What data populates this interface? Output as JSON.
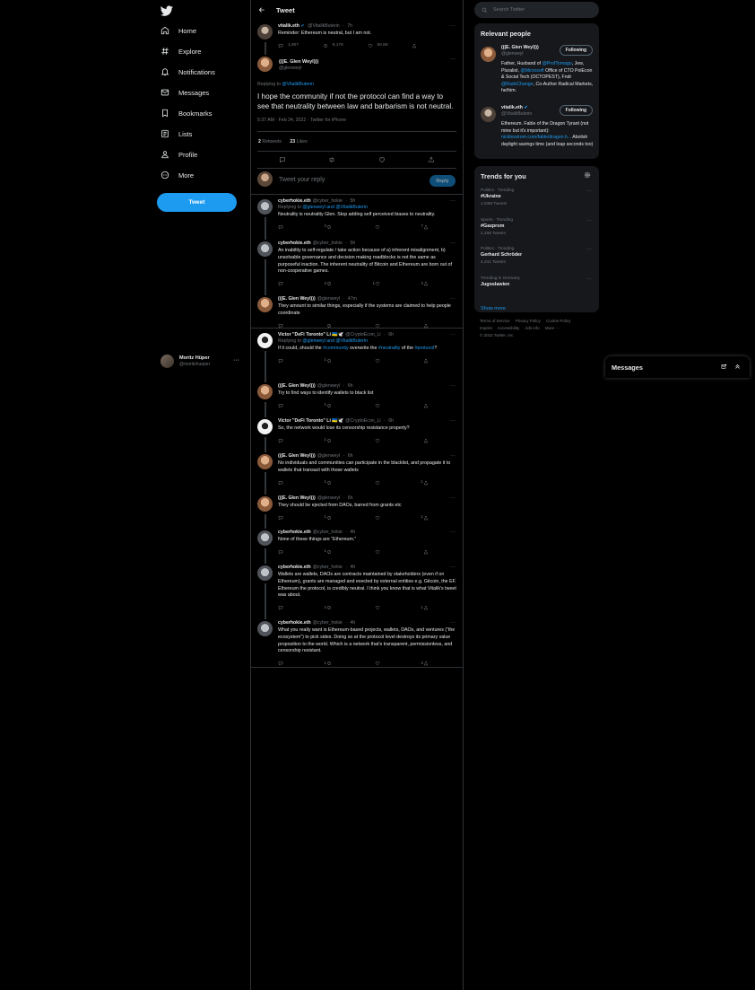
{
  "nav": {
    "items": [
      {
        "label": "Home",
        "icon": "home-icon"
      },
      {
        "label": "Explore",
        "icon": "explore-icon"
      },
      {
        "label": "Notifications",
        "icon": "notifications-icon"
      },
      {
        "label": "Messages",
        "icon": "messages-icon"
      },
      {
        "label": "Bookmarks",
        "icon": "bookmarks-icon"
      },
      {
        "label": "Lists",
        "icon": "lists-icon"
      },
      {
        "label": "Profile",
        "icon": "profile-icon"
      },
      {
        "label": "More",
        "icon": "more-icon"
      }
    ],
    "tweet_button": "Tweet",
    "account": {
      "name": "Moritz Hüper",
      "handle": "@moritzhueper"
    }
  },
  "header": {
    "title": "Tweet"
  },
  "quoted_parent": {
    "name": "vitalik.eth",
    "handle": "@VitalikButerin",
    "time": "7h",
    "text": "Reminder: Ethereum is neutral, but I am not.",
    "replies": "1,907",
    "retweets": "8,176",
    "likes": "50.8K"
  },
  "main_tweet": {
    "name": "(((E. Glen Weyl)))",
    "handle": "@glenweyl",
    "replying_prefix": "Replying to",
    "replying_to": "@VitalikButerin",
    "text": "I hope the community if not the protocol can find a way to see that neutrality between law and barbarism is not neutral.",
    "meta": "5:37 AM · Feb 24, 2022 · Twitter for iPhone",
    "retweets_count": "2",
    "retweets_label": "Retweets",
    "likes_count": "23",
    "likes_label": "Likes"
  },
  "composer": {
    "placeholder": "Tweet your reply",
    "button": "Reply"
  },
  "replies": [
    {
      "name": "cyberhokie.eth",
      "handle": "@cyber_hokie",
      "time": "5h",
      "av": "cyb",
      "replying": "Replying to ",
      "replying_to": "@glenweyl and @VitalikButerin",
      "text": "Neutrality is neutrality Glen. Stop adding self perceived biases to neutrality.",
      "r": "2",
      "rt": "",
      "l": "7",
      "thread": true
    },
    {
      "name": "cyberhokie.eth",
      "handle": "@cyber_hokie",
      "time": "5h",
      "av": "cyb",
      "text": "An inability to self-regulate / take action  because of a) inherent misalignment, b) unsolvable governance and decision making roadblocks is not the same as purposeful inaction. The inherent neutrality of Bitcoin and Ethereum are born out of non-cooperative games.",
      "r": "2",
      "rt": "1",
      "l": "3",
      "thread": true
    },
    {
      "name": "(((E. Glen Weyl)))",
      "handle": "@glenweyl",
      "time": "47m",
      "av": "glen",
      "text": "They amount to similar things, especially if the systems are claimed to help people coordinate",
      "r": "",
      "rt": "",
      "l": "",
      "sep": true
    },
    {
      "name": "Victor \"DeFi Toronto\" Li 🇺🇦🕊️",
      "handle": "@CryptoEcon_Li",
      "time": "6h",
      "av": "vic",
      "replying": "Replying to ",
      "replying_to": "@glenweyl and @VitalikButerin",
      "text_pre": "If it could, should the ",
      "text_tag1": "#community",
      "text_mid": " overwrite the ",
      "text_tag2": "#neutrality",
      "text_mid2": " of the ",
      "text_tag3": "#protocol",
      "text_post": "?",
      "r": "1",
      "rt": "",
      "l": "",
      "thread": true,
      "rich": true
    },
    {
      "name": "(((E. Glen Weyl)))",
      "handle": "@glenweyl",
      "time": "6h",
      "av": "glen",
      "text": "Try to find ways to identify wallets to black list",
      "r": "1",
      "rt": "",
      "l": "",
      "thread": true
    },
    {
      "name": "Victor \"DeFi Toronto\" Li 🇺🇦🕊️",
      "handle": "@CryptoEcon_Li",
      "time": "6h",
      "av": "vic",
      "text": "So, the network would lose its censorship resistance property?",
      "r": "1",
      "rt": "",
      "l": "",
      "thread": true
    },
    {
      "name": "(((E. Glen Weyl)))",
      "handle": "@glenweyl",
      "time": "6h",
      "av": "glen",
      "text": "No individuals and communities can participate in the blacklist, and propagate it to wallets that transact with those wallets",
      "r": "1",
      "rt": "",
      "l": "1",
      "thread": true
    },
    {
      "name": "(((E. Glen Weyl)))",
      "handle": "@glenweyl",
      "time": "6h",
      "av": "glen",
      "text": "They should be ejected from DAOs, barred from grants etc",
      "r": "1",
      "rt": "",
      "l": "1",
      "thread": true
    },
    {
      "name": "cyberhokie.eth",
      "handle": "@cyber_hokie",
      "time": "4h",
      "av": "cyb",
      "text": "None of these things are “Ethereum.”",
      "r": "1",
      "rt": "",
      "l": "",
      "thread": true
    },
    {
      "name": "cyberhokie.eth",
      "handle": "@cyber_hokie",
      "time": "4h",
      "av": "cyb",
      "text": "Wallets are wallets, DAOs are contracts maintained by stakeholders (even if on Ethereum), grants are managed and exected by external entities e.g. Gitcoin, the EF. Ethereum the protocol, is credibly neutral. I think you know that is what Vitalik’s tweet was about.",
      "r": "2",
      "rt": "",
      "l": "1",
      "thread": true
    },
    {
      "name": "cyberhokie.eth",
      "handle": "@cyber_hokie",
      "time": "4h",
      "av": "cyb",
      "text": "What you really want is Ethereum-based projects, wallets, DAOs, and ventures (“the ecosystem”) to pick sides. Doing so at the protocol level destroys its primary value proposition to the world. Which is a network that’s transparent, permissionless, and censorship resistant.",
      "r": "1",
      "rt": "",
      "l": "2",
      "sep": true
    }
  ],
  "search": {
    "placeholder": "Search Twitter"
  },
  "relevant": {
    "title": "Relevant people",
    "people": [
      {
        "name": "(((E. Glen Weyl)))",
        "handle": "@glenweyl",
        "button": "Following",
        "bio_1": "Father, Husband of ",
        "bio_link1": "@ProfTomago",
        "bio_2": ", Jew, Pluralist, ",
        "bio_link2": "@Microsoft",
        "bio_3": " Office of CTO PolEcon & Social Tech (OCTOPEST), Fndr ",
        "bio_link3": "@RadxChange",
        "bio_4": ", Co-Author Radical Markets, he/him."
      },
      {
        "name": "vitalik.eth",
        "handle": "@VitalikButerin",
        "button": "Following",
        "bio_1": "Ethereum. Fable of the Dragon Tyrant (not mine but it's important): ",
        "bio_link1": "nickbostrom.com/fable/dragon.h...",
        "bio_2": " Abolish daylight savings time (and leap seconds too)"
      }
    ]
  },
  "trends": {
    "title": "Trends for you",
    "items": [
      {
        "cat": "Politics · Trending",
        "name": "#Ukraine",
        "count": "1.03M Tweets"
      },
      {
        "cat": "Sports · Trending",
        "name": "#Gazprom",
        "count": "2,158 Tweets"
      },
      {
        "cat": "Politics · Trending",
        "name": "Gerhard Schröder",
        "count": "4,341 Tweets"
      },
      {
        "cat": "Trending in Germany",
        "name": "Jugoslawien",
        "count": ""
      }
    ],
    "show_more": "Show more"
  },
  "footer": {
    "links": [
      "Terms of Service",
      "Privacy Policy",
      "Cookie Policy",
      "Imprint",
      "Accessibility",
      "Ads info",
      "More ···"
    ],
    "copyright": "© 2022 Twitter, Inc."
  },
  "messages": {
    "title": "Messages"
  },
  "colors": {
    "accent": "#1d9bf0",
    "background": "#000000",
    "border": "#2f3336",
    "muted": "#71767b"
  }
}
